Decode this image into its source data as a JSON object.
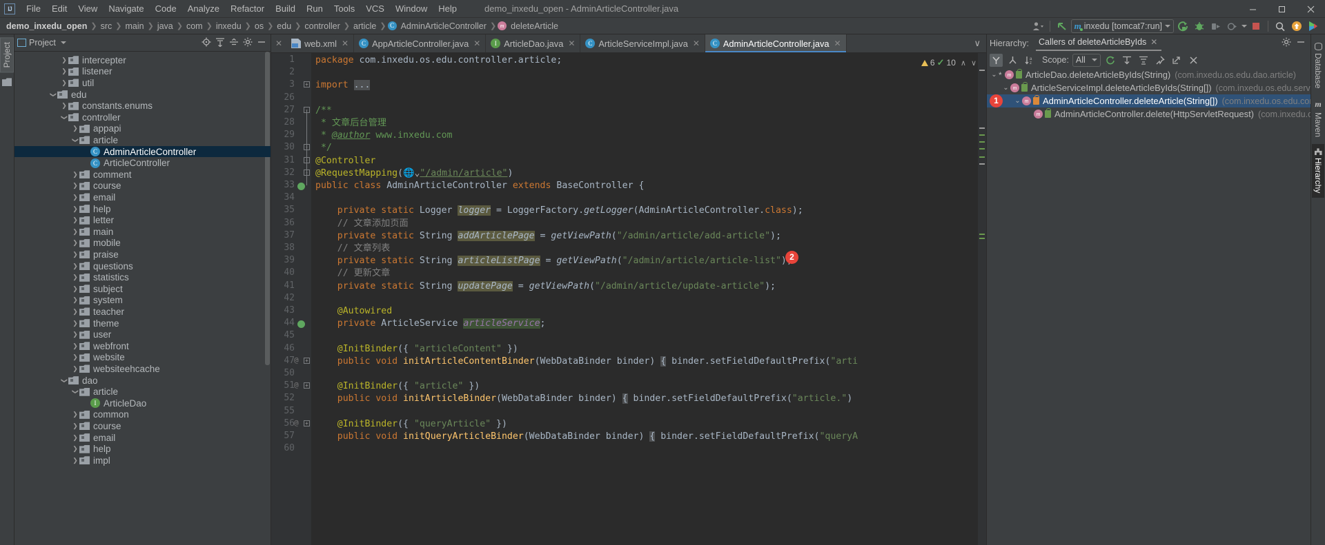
{
  "window": {
    "title": "demo_inxedu_open - AdminArticleController.java",
    "buttons": {
      "minimize": "─",
      "maximize": "☐",
      "close": "✕"
    }
  },
  "menu": {
    "items": [
      "File",
      "Edit",
      "View",
      "Navigate",
      "Code",
      "Analyze",
      "Refactor",
      "Build",
      "Run",
      "Tools",
      "VCS",
      "Window",
      "Help"
    ]
  },
  "navbar": {
    "breadcrumbs": [
      {
        "label": "demo_inxedu_open",
        "icon": ""
      },
      {
        "label": "src",
        "icon": ""
      },
      {
        "label": "main",
        "icon": ""
      },
      {
        "label": "java",
        "icon": ""
      },
      {
        "label": "com",
        "icon": ""
      },
      {
        "label": "inxedu",
        "icon": ""
      },
      {
        "label": "os",
        "icon": ""
      },
      {
        "label": "edu",
        "icon": ""
      },
      {
        "label": "controller",
        "icon": ""
      },
      {
        "label": "article",
        "icon": ""
      },
      {
        "label": "AdminArticleController",
        "icon": "class-icon",
        "badge": "C"
      },
      {
        "label": "deleteArticle",
        "icon": "method-icon",
        "badge": "m"
      }
    ],
    "separator": "❯",
    "run_config": {
      "label": "inxedu [tomcat7:run]",
      "icon": "maven-icon",
      "dropdown_caret": "▾"
    },
    "toolbar_icons": [
      "user-avatar-icon",
      "undo-arrow-icon",
      "run-icon",
      "debug-icon",
      "run-with-coverage-icon",
      "profile-icon",
      "stop-icon",
      "search-everywhere-icon",
      "update-project-icon",
      "run-anything-icon"
    ]
  },
  "left_strip": {
    "tabs": [
      "Project"
    ],
    "icon": "structure-icon"
  },
  "project_panel": {
    "title": "Project",
    "actions": [
      "locate-icon",
      "expand-all-icon",
      "collapse-all-icon",
      "settings-icon",
      "hide-icon"
    ],
    "tree": [
      {
        "label": "intercepter",
        "depth": 3,
        "type": "folder",
        "state": "collapsed"
      },
      {
        "label": "listener",
        "depth": 3,
        "type": "folder",
        "state": "collapsed"
      },
      {
        "label": "util",
        "depth": 3,
        "type": "folder",
        "state": "collapsed"
      },
      {
        "label": "edu",
        "depth": 2,
        "type": "folder",
        "state": "expanded"
      },
      {
        "label": "constants.enums",
        "depth": 3,
        "type": "folder",
        "state": "collapsed"
      },
      {
        "label": "controller",
        "depth": 3,
        "type": "folder",
        "state": "expanded"
      },
      {
        "label": "appapi",
        "depth": 4,
        "type": "folder",
        "state": "collapsed"
      },
      {
        "label": "article",
        "depth": 4,
        "type": "folder",
        "state": "expanded"
      },
      {
        "label": "AdminArticleController",
        "depth": 5,
        "type": "class",
        "state": "leaf",
        "selected": true
      },
      {
        "label": "ArticleController",
        "depth": 5,
        "type": "class",
        "state": "leaf"
      },
      {
        "label": "comment",
        "depth": 4,
        "type": "folder",
        "state": "collapsed"
      },
      {
        "label": "course",
        "depth": 4,
        "type": "folder",
        "state": "collapsed"
      },
      {
        "label": "email",
        "depth": 4,
        "type": "folder",
        "state": "collapsed"
      },
      {
        "label": "help",
        "depth": 4,
        "type": "folder",
        "state": "collapsed"
      },
      {
        "label": "letter",
        "depth": 4,
        "type": "folder",
        "state": "collapsed"
      },
      {
        "label": "main",
        "depth": 4,
        "type": "folder",
        "state": "collapsed"
      },
      {
        "label": "mobile",
        "depth": 4,
        "type": "folder",
        "state": "collapsed"
      },
      {
        "label": "praise",
        "depth": 4,
        "type": "folder",
        "state": "collapsed"
      },
      {
        "label": "questions",
        "depth": 4,
        "type": "folder",
        "state": "collapsed"
      },
      {
        "label": "statistics",
        "depth": 4,
        "type": "folder",
        "state": "collapsed"
      },
      {
        "label": "subject",
        "depth": 4,
        "type": "folder",
        "state": "collapsed"
      },
      {
        "label": "system",
        "depth": 4,
        "type": "folder",
        "state": "collapsed"
      },
      {
        "label": "teacher",
        "depth": 4,
        "type": "folder",
        "state": "collapsed"
      },
      {
        "label": "theme",
        "depth": 4,
        "type": "folder",
        "state": "collapsed"
      },
      {
        "label": "user",
        "depth": 4,
        "type": "folder",
        "state": "collapsed"
      },
      {
        "label": "webfront",
        "depth": 4,
        "type": "folder",
        "state": "collapsed"
      },
      {
        "label": "website",
        "depth": 4,
        "type": "folder",
        "state": "collapsed"
      },
      {
        "label": "websiteehcache",
        "depth": 4,
        "type": "folder",
        "state": "collapsed"
      },
      {
        "label": "dao",
        "depth": 3,
        "type": "folder",
        "state": "expanded"
      },
      {
        "label": "article",
        "depth": 4,
        "type": "folder",
        "state": "expanded"
      },
      {
        "label": "ArticleDao",
        "depth": 5,
        "type": "interface",
        "state": "leaf"
      },
      {
        "label": "common",
        "depth": 4,
        "type": "folder",
        "state": "collapsed"
      },
      {
        "label": "course",
        "depth": 4,
        "type": "folder",
        "state": "collapsed"
      },
      {
        "label": "email",
        "depth": 4,
        "type": "folder",
        "state": "collapsed"
      },
      {
        "label": "help",
        "depth": 4,
        "type": "folder",
        "state": "collapsed"
      },
      {
        "label": "impl",
        "depth": 4,
        "type": "folder",
        "state": "collapsed"
      }
    ]
  },
  "editor": {
    "tabs": [
      {
        "label": "web.xml",
        "icon": "xml-icon",
        "active": false
      },
      {
        "label": "AppArticleController.java",
        "icon": "class-icon",
        "active": false
      },
      {
        "label": "ArticleDao.java",
        "icon": "interface-icon",
        "active": false
      },
      {
        "label": "ArticleServiceImpl.java",
        "icon": "class-icon",
        "active": false
      },
      {
        "label": "AdminArticleController.java",
        "icon": "class-icon",
        "active": true
      }
    ],
    "inspection": {
      "warnings": "6",
      "checks": "10",
      "up_caret": "∧",
      "down_caret": "∨"
    },
    "line_numbers": [
      "1",
      "2",
      "3",
      "26",
      "27",
      "28",
      "29",
      "30",
      "31",
      "32",
      "33",
      "34",
      "35",
      "36",
      "37",
      "38",
      "39",
      "40",
      "41",
      "42",
      "43",
      "44",
      "45",
      "46",
      "47",
      "50",
      "51",
      "52",
      "55",
      "56",
      "57",
      "60"
    ],
    "code_lines": [
      "package com.inxedu.os.edu.controller.article;",
      "",
      "import ...",
      "",
      "/**",
      " * 文章后台管理",
      " * @author www.inxedu.com",
      " */",
      "@Controller",
      "@RequestMapping(\"/admin/article\")",
      "public class AdminArticleController extends BaseController {",
      "",
      "    private static Logger logger = LoggerFactory.getLogger(AdminArticleController.class);",
      "    // 文章添加页面",
      "    private static String addArticlePage = getViewPath(\"/admin/article/add-article\");",
      "    // 文章列表",
      "    private static String articleListPage = getViewPath(\"/admin/article/article-list\");",
      "    // 更新文章",
      "    private static String updatePage = getViewPath(\"/admin/article/update-article\");",
      "",
      "    @Autowired",
      "    private ArticleService articleService;",
      "",
      "    @InitBinder({ \"articleContent\" })",
      "    public void initArticleContentBinder(WebDataBinder binder) { binder.setFieldDefaultPrefix(\"arti",
      "",
      "    @InitBinder({ \"article\" })",
      "    public void initArticleBinder(WebDataBinder binder) { binder.setFieldDefaultPrefix(\"article.\")",
      "",
      "    @InitBinder({ \"queryArticle\" })",
      "    public void initQueryArticleBinder(WebDataBinder binder) { binder.setFieldDefaultPrefix(\"queryA",
      ""
    ]
  },
  "annotations": [
    {
      "id": "1",
      "label": "1"
    },
    {
      "id": "2",
      "label": "2"
    }
  ],
  "hierarchy": {
    "label": "Hierarchy:",
    "tab": "Callers of deleteArticleByIds",
    "tab_close": "✕",
    "actions": [
      "settings-icon",
      "hide-icon"
    ],
    "toolbar": {
      "buttons": [
        "callers-hierarchy-icon",
        "callees-hierarchy-icon",
        "sort-alphabetically-icon",
        "refresh-icon",
        "expand-all-icon",
        "collapse-all-icon",
        "pin-icon",
        "export-icon",
        "close-icon"
      ],
      "scope_label": "Scope:",
      "scope_value": "All",
      "scope_caret": "▾"
    },
    "rows": [
      {
        "depth": 0,
        "marker": "*",
        "arrow": "⌄",
        "name": "ArticleDao.deleteArticleByIds(String)",
        "package": "(com.inxedu.os.edu.dao.article)",
        "lock": "green",
        "selected": false
      },
      {
        "depth": 1,
        "marker": "",
        "arrow": "⌄",
        "name": "ArticleServiceImpl.deleteArticleByIds(String[])",
        "package": "(com.inxedu.os.edu.service.impl.arti",
        "lock": "green",
        "selected": false
      },
      {
        "depth": 2,
        "marker": "",
        "arrow": "⌄",
        "name": "AdminArticleController.deleteArticle(String[])",
        "package": "(com.inxedu.os.edu.controller.art",
        "lock": "orange",
        "selected": true
      },
      {
        "depth": 3,
        "marker": "",
        "arrow": "",
        "name": "AdminArticleController.delete(HttpServletRequest)",
        "package": "(com.inxedu.os.edu.cont",
        "lock": "green",
        "selected": false
      }
    ]
  },
  "right_strip": {
    "tabs": [
      {
        "label": "Database",
        "icon": "database-icon",
        "active": false
      },
      {
        "label": "Maven",
        "icon": "maven-icon",
        "active": false
      },
      {
        "label": "Hierarchy",
        "icon": "hierarchy-icon",
        "active": true
      }
    ]
  },
  "colors": {
    "accent": "#4a88c7",
    "selection": "#2f5278",
    "badge_red": "#e8443a",
    "editor_bg": "#2b2b2b",
    "panel_bg": "#3c3f41"
  }
}
